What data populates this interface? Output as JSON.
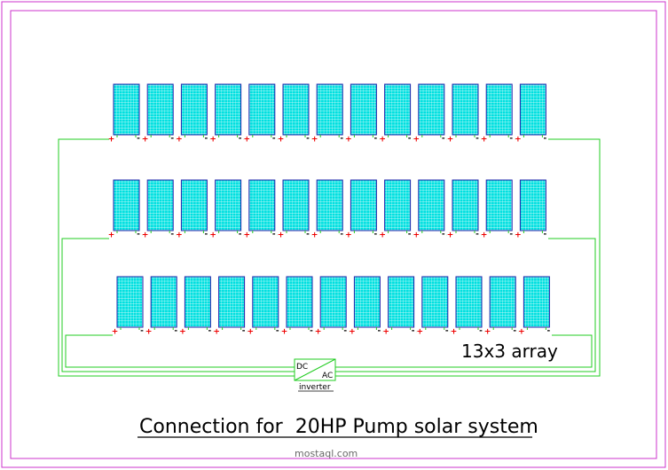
{
  "diagram": {
    "title": "Connection for  20HP Pump solar system",
    "array_label": "13x3 array",
    "inverter": {
      "dc_label": "DC",
      "ac_label": "AC",
      "name_label": "inverter"
    },
    "rows": 3,
    "panels_per_row": 13,
    "polarity": {
      "plus": "+",
      "minus": "-"
    },
    "watermark": "mostaql.com",
    "colors": {
      "frame": "#cc33cc",
      "panel_fill": "#00e0e0",
      "panel_grid": "#ffffff",
      "panel_border": "#2222aa",
      "wire": "#22cc22",
      "plus": "#ee0000",
      "minus": "#000000",
      "text": "#000000"
    }
  }
}
